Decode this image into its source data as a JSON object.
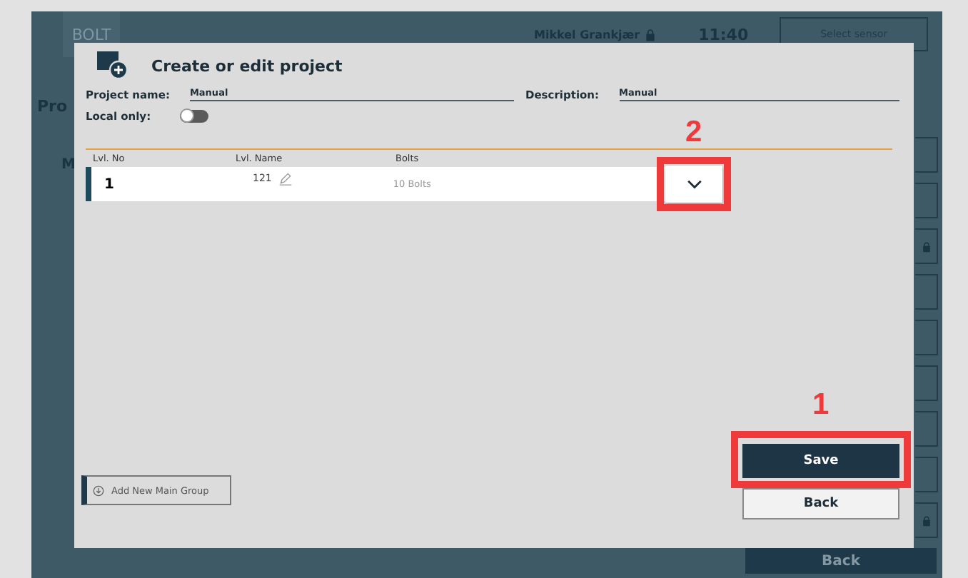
{
  "app": {
    "logo": "BOLT",
    "user": "Mikkel Grankjær",
    "time": "11:40",
    "sensor_button": "Select sensor",
    "page_title": "Pro",
    "panel_label": "M",
    "back_button": "Back",
    "side_buttons": [
      {
        "locked": false
      },
      {
        "locked": false
      },
      {
        "locked": true
      },
      {
        "locked": false
      },
      {
        "locked": false
      },
      {
        "locked": false
      },
      {
        "locked": false
      },
      {
        "locked": false
      },
      {
        "locked": true
      }
    ]
  },
  "dialog": {
    "title": "Create or edit project",
    "fields": [
      {
        "label": "Project name:",
        "value": "Manual"
      },
      {
        "label": "Description:",
        "value": "Manual"
      }
    ],
    "local_only": {
      "label": "Local only:",
      "on": false
    },
    "columns": [
      "Lvl. No",
      "Lvl. Name",
      "Bolts"
    ],
    "rows": [
      {
        "number": "1",
        "name": "121",
        "bolts": "10 Bolts",
        "expanded": false
      }
    ],
    "add_button": "Add New Main Group",
    "save_button": "Save",
    "back_button": "Back"
  },
  "annotations": [
    {
      "label": "2"
    },
    {
      "label": "1"
    }
  ]
}
